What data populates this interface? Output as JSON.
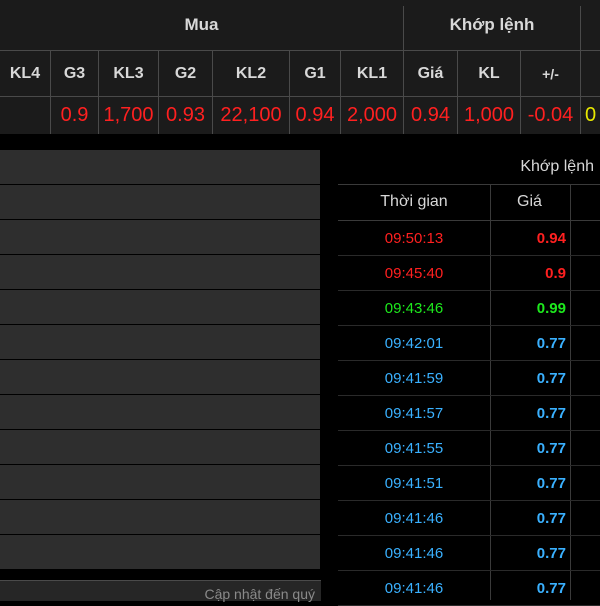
{
  "header": {
    "group_mua": "Mua",
    "group_khop": "Khớp lệnh",
    "columns": [
      "KL4",
      "G3",
      "KL3",
      "G2",
      "KL2",
      "G1",
      "KL1",
      "Giá",
      "KL",
      "+/-"
    ],
    "values": [
      "",
      "0.9",
      "1,700",
      "0.93",
      "22,100",
      "0.94",
      "2,000",
      "0.94",
      "1,000",
      "-0.04",
      "0"
    ]
  },
  "left_panel": {
    "footer_text": "Cập nhật đến quý"
  },
  "trades": {
    "title": "Khớp lệnh",
    "col_time": "Thời gian",
    "col_price": "Giá",
    "rows": [
      {
        "time": "09:50:13",
        "price": "0.94",
        "color": "#ff2020"
      },
      {
        "time": "09:45:40",
        "price": "0.9",
        "color": "#ff2020"
      },
      {
        "time": "09:43:46",
        "price": "0.99",
        "color": "#1de91d"
      },
      {
        "time": "09:42:01",
        "price": "0.77",
        "color": "#3ab1ff"
      },
      {
        "time": "09:41:59",
        "price": "0.77",
        "color": "#3ab1ff"
      },
      {
        "time": "09:41:57",
        "price": "0.77",
        "color": "#3ab1ff"
      },
      {
        "time": "09:41:55",
        "price": "0.77",
        "color": "#3ab1ff"
      },
      {
        "time": "09:41:51",
        "price": "0.77",
        "color": "#3ab1ff"
      },
      {
        "time": "09:41:46",
        "price": "0.77",
        "color": "#3ab1ff"
      },
      {
        "time": "09:41:46",
        "price": "0.77",
        "color": "#3ab1ff"
      },
      {
        "time": "09:41:46",
        "price": "0.77",
        "color": "#3ab1ff"
      }
    ]
  }
}
